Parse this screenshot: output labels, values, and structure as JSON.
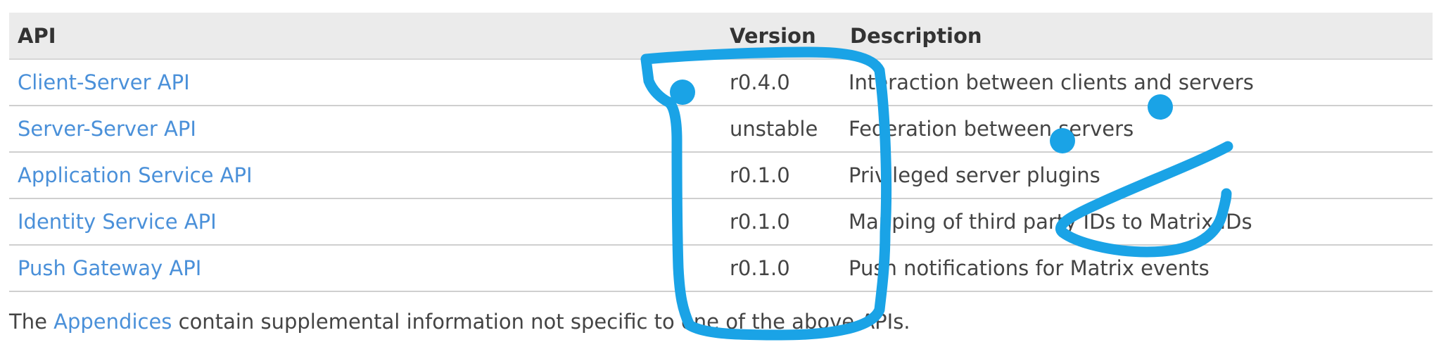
{
  "table": {
    "headers": {
      "api": "API",
      "version": "Version",
      "description": "Description"
    },
    "rows": [
      {
        "api": "Client-Server API",
        "version": "r0.4.0",
        "description": "Interaction between clients and servers"
      },
      {
        "api": "Server-Server API",
        "version": "unstable",
        "description": "Federation between servers"
      },
      {
        "api": "Application Service API",
        "version": "r0.1.0",
        "description": "Privileged server plugins"
      },
      {
        "api": "Identity Service API",
        "version": "r0.1.0",
        "description": "Mapping of third party IDs to Matrix IDs"
      },
      {
        "api": "Push Gateway API",
        "version": "r0.1.0",
        "description": "Push notifications for Matrix events"
      }
    ]
  },
  "footnote": {
    "prefix": "The",
    "link": "Appendices",
    "suffix": "contain supplemental information not specific to one of the above APIs."
  },
  "colors": {
    "link": "#4a90d9",
    "header_bg": "#ebebeb",
    "annotation": "#1aa3e6"
  },
  "annotation_icons": [
    "freehand-box-stroke",
    "smiley-face-doodle"
  ]
}
